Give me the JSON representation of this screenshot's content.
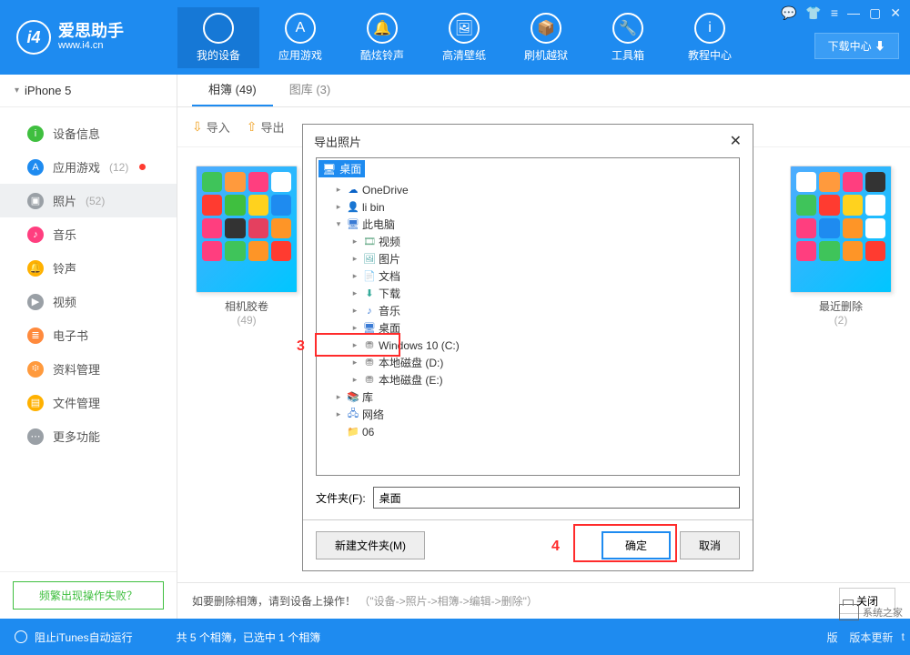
{
  "brand": {
    "name": "爱思助手",
    "url": "www.i4.cn",
    "logo_text": "i4"
  },
  "nav": [
    {
      "label": "我的设备"
    },
    {
      "label": "应用游戏"
    },
    {
      "label": "酷炫铃声"
    },
    {
      "label": "高清壁纸"
    },
    {
      "label": "刷机越狱"
    },
    {
      "label": "工具箱"
    },
    {
      "label": "教程中心"
    }
  ],
  "download_center": "下载中心 ⬇",
  "device_name": "iPhone 5",
  "sidebar": [
    {
      "label": "设备信息",
      "color": "#3fbf3f",
      "glyph": "i"
    },
    {
      "label": "应用游戏",
      "count": "(12)",
      "dot": true,
      "color": "#1e8bf0",
      "glyph": "A"
    },
    {
      "label": "照片",
      "count": "(52)",
      "active": true,
      "color": "#9aa0a6",
      "glyph": "▣"
    },
    {
      "label": "音乐",
      "color": "#ff3e7f",
      "glyph": "♪"
    },
    {
      "label": "铃声",
      "color": "#ffb100",
      "glyph": "🔔"
    },
    {
      "label": "视频",
      "color": "#9aa0a6",
      "glyph": "▶"
    },
    {
      "label": "电子书",
      "color": "#ff8a3d",
      "glyph": "≣"
    },
    {
      "label": "资料管理",
      "color": "#ff9a3d",
      "glyph": "፨"
    },
    {
      "label": "文件管理",
      "color": "#ffb100",
      "glyph": "▤"
    },
    {
      "label": "更多功能",
      "color": "#9aa0a6",
      "glyph": "⋯"
    }
  ],
  "fail_button": "频繁出现操作失败？",
  "tabs": [
    {
      "label": "相簿 (49)",
      "active": true
    },
    {
      "label": "图库 (3)"
    }
  ],
  "toolbar": {
    "import": "导入",
    "export": "导出"
  },
  "albums": [
    {
      "name": "相机胶卷",
      "count": "(49)"
    },
    {
      "name": "最近删除",
      "count": "(2)"
    }
  ],
  "footer_hint_a": "如要删除相簿，请到设备上操作！",
  "footer_hint_b": "（\"设备->照片->相簿->编辑->删除\"）",
  "close_label": "关闭",
  "status_left": "阻止iTunes自动运行",
  "status_center": "共 5 个相簿，已选中 1 个相簿",
  "status_right": "版本更新",
  "watermark": "系统之家",
  "dialog": {
    "title": "导出照片",
    "selected": "桌面",
    "tree": [
      {
        "ind": 1,
        "exp": "▸",
        "icon": "☁",
        "ic": "#0a63c7",
        "label": "OneDrive"
      },
      {
        "ind": 1,
        "exp": "▸",
        "icon": "👤",
        "ic": "#777",
        "label": "li bin"
      },
      {
        "ind": 1,
        "exp": "▾",
        "icon": "🖥",
        "ic": "#3a7bd5",
        "label": "此电脑"
      },
      {
        "ind": 2,
        "exp": "▸",
        "icon": "🎞",
        "ic": "#6a8",
        "label": "视频"
      },
      {
        "ind": 2,
        "exp": "▸",
        "icon": "🖼",
        "ic": "#5aa",
        "label": "图片"
      },
      {
        "ind": 2,
        "exp": "▸",
        "icon": "📄",
        "ic": "#7aa",
        "label": "文档"
      },
      {
        "ind": 2,
        "exp": "▸",
        "icon": "⬇",
        "ic": "#3a9",
        "label": "下载"
      },
      {
        "ind": 2,
        "exp": "▸",
        "icon": "♪",
        "ic": "#3a7bd5",
        "label": "音乐"
      },
      {
        "ind": 2,
        "exp": "▸",
        "icon": "🖥",
        "ic": "#3a7bd5",
        "label": "桌面",
        "hl": true
      },
      {
        "ind": 2,
        "exp": "▸",
        "icon": "⛃",
        "ic": "#888",
        "label": "Windows 10 (C:)"
      },
      {
        "ind": 2,
        "exp": "▸",
        "icon": "⛃",
        "ic": "#888",
        "label": "本地磁盘 (D:)"
      },
      {
        "ind": 2,
        "exp": "▸",
        "icon": "⛃",
        "ic": "#888",
        "label": "本地磁盘 (E:)"
      },
      {
        "ind": 1,
        "exp": "▸",
        "icon": "📚",
        "ic": "#5aa",
        "label": "库"
      },
      {
        "ind": 1,
        "exp": "▸",
        "icon": "🖧",
        "ic": "#3a7bd5",
        "label": "网络"
      },
      {
        "ind": 1,
        "exp": "",
        "icon": "📁",
        "ic": "#f3d16b",
        "label": "06"
      }
    ],
    "folder_label": "文件夹(F):",
    "folder_value": "桌面",
    "new_folder": "新建文件夹(M)",
    "ok": "确定",
    "cancel": "取消"
  },
  "annotations": {
    "n3": "3",
    "n4": "4"
  }
}
